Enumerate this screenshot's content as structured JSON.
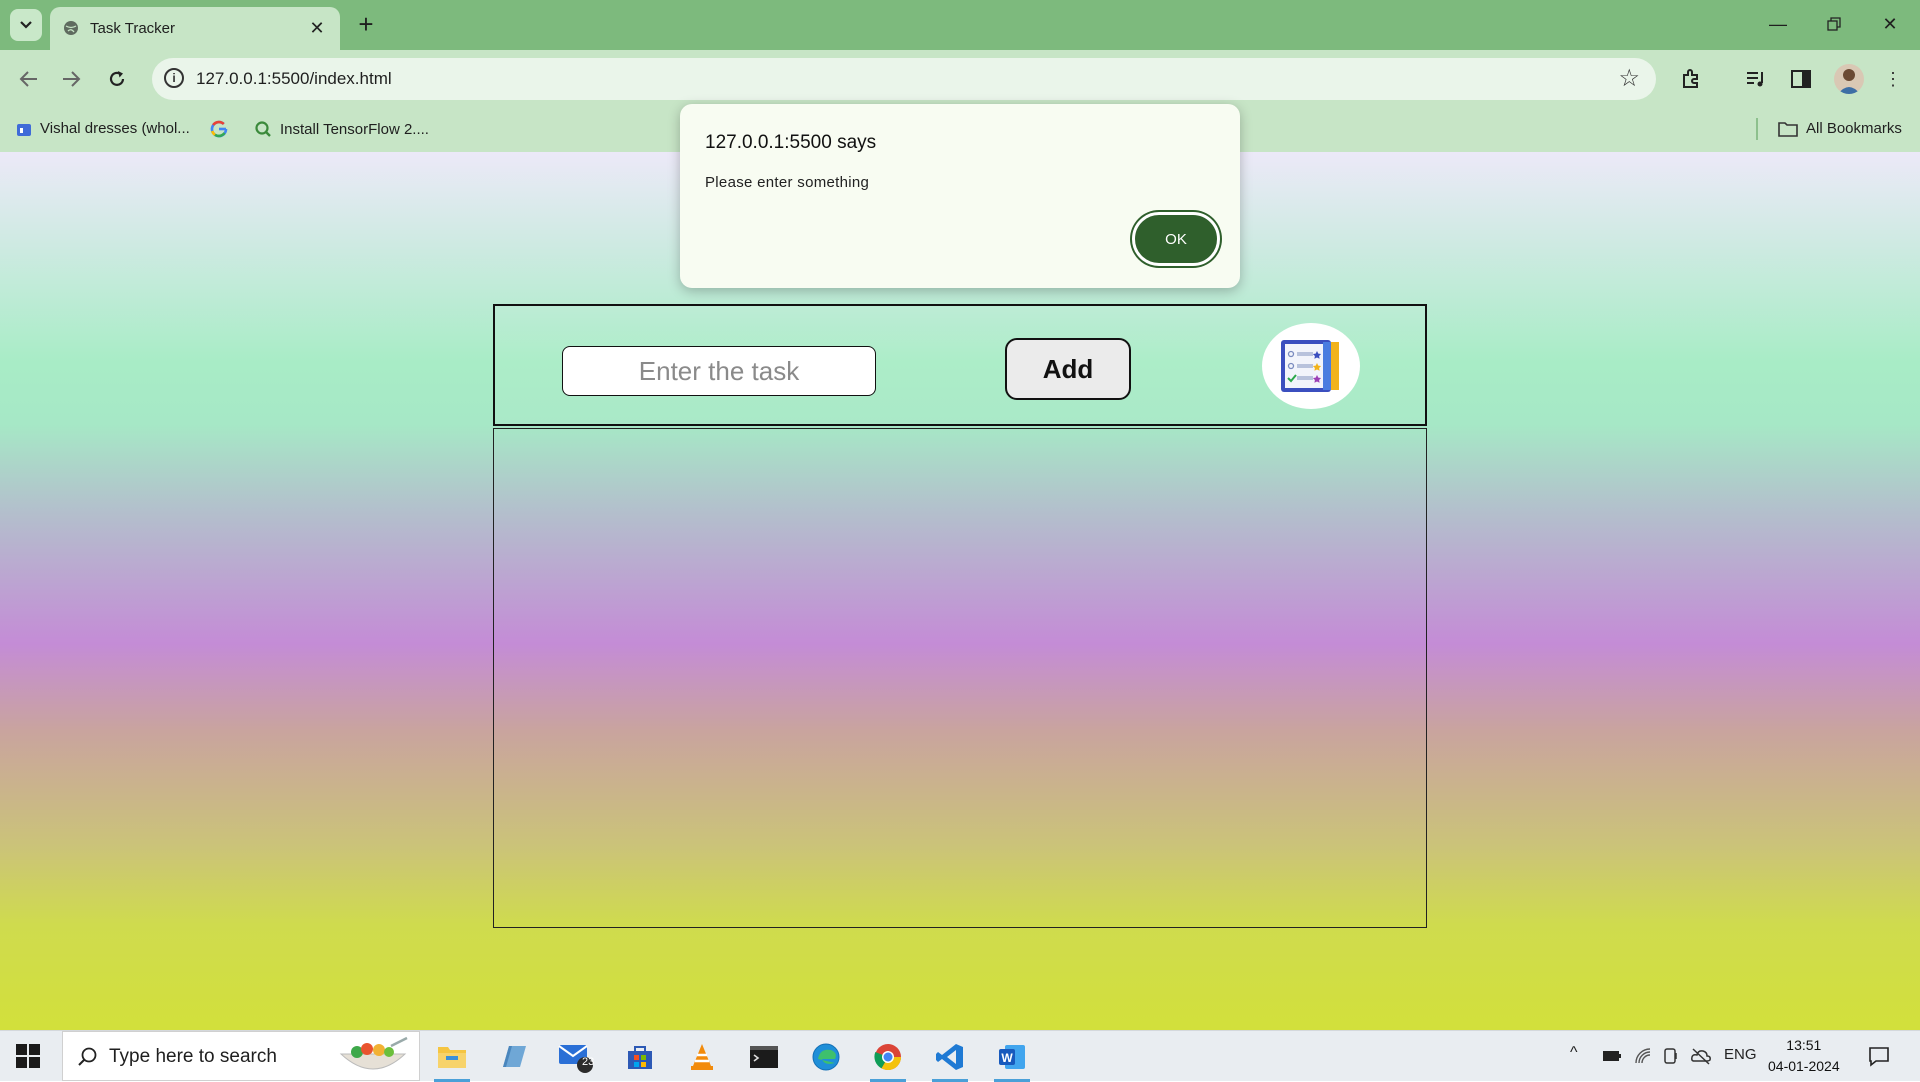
{
  "browser": {
    "tab_title": "Task Tracker",
    "url": "127.0.0.1:5500/index.html",
    "bookmarks": [
      {
        "label": "Vishal dresses (whol..."
      },
      {
        "label": ""
      },
      {
        "label": "Install TensorFlow 2...."
      }
    ],
    "all_bookmarks_label": "All Bookmarks"
  },
  "app": {
    "task_input_placeholder": "Enter the task",
    "task_input_value": "",
    "add_label": "Add"
  },
  "dialog": {
    "title": "127.0.0.1:5500 says",
    "message": "Please enter something",
    "ok_label": "OK"
  },
  "taskbar": {
    "search_placeholder": "Type here to search",
    "mail_badge": "23",
    "language": "ENG",
    "time": "13:51",
    "date": "04-01-2024"
  },
  "colors": {
    "tab_strip": "#7dba7d",
    "toolbar": "#c7e5c6",
    "ok_button": "#2f5f2c"
  }
}
